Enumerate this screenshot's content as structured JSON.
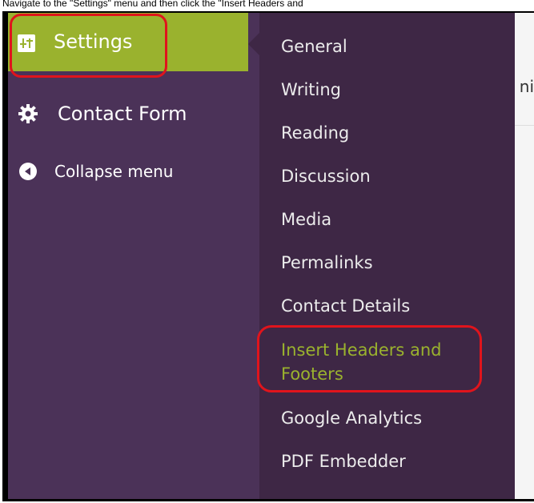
{
  "caption": "Navigate to the \"Settings\" menu and then click the \"Insert Headers and",
  "sidebar": {
    "settings_label": "Settings",
    "contact_form_label": "Contact Form",
    "collapse_label": "Collapse menu"
  },
  "submenu": {
    "items": [
      "General",
      "Writing",
      "Reading",
      "Discussion",
      "Media",
      "Permalinks",
      "Contact Details",
      "Insert Headers and",
      "Footers",
      "Google Analytics",
      "PDF Embedder"
    ]
  },
  "content": {
    "peek_text": "ni"
  },
  "colors": {
    "sidebar_bg": "#4b3258",
    "submenu_bg": "#3e2745",
    "active": "#9ab22e",
    "highlight": "#e0141c"
  },
  "icons": {
    "settings": "sliders-icon",
    "contact_form": "gear-icon",
    "collapse": "collapse-arrow-icon"
  }
}
